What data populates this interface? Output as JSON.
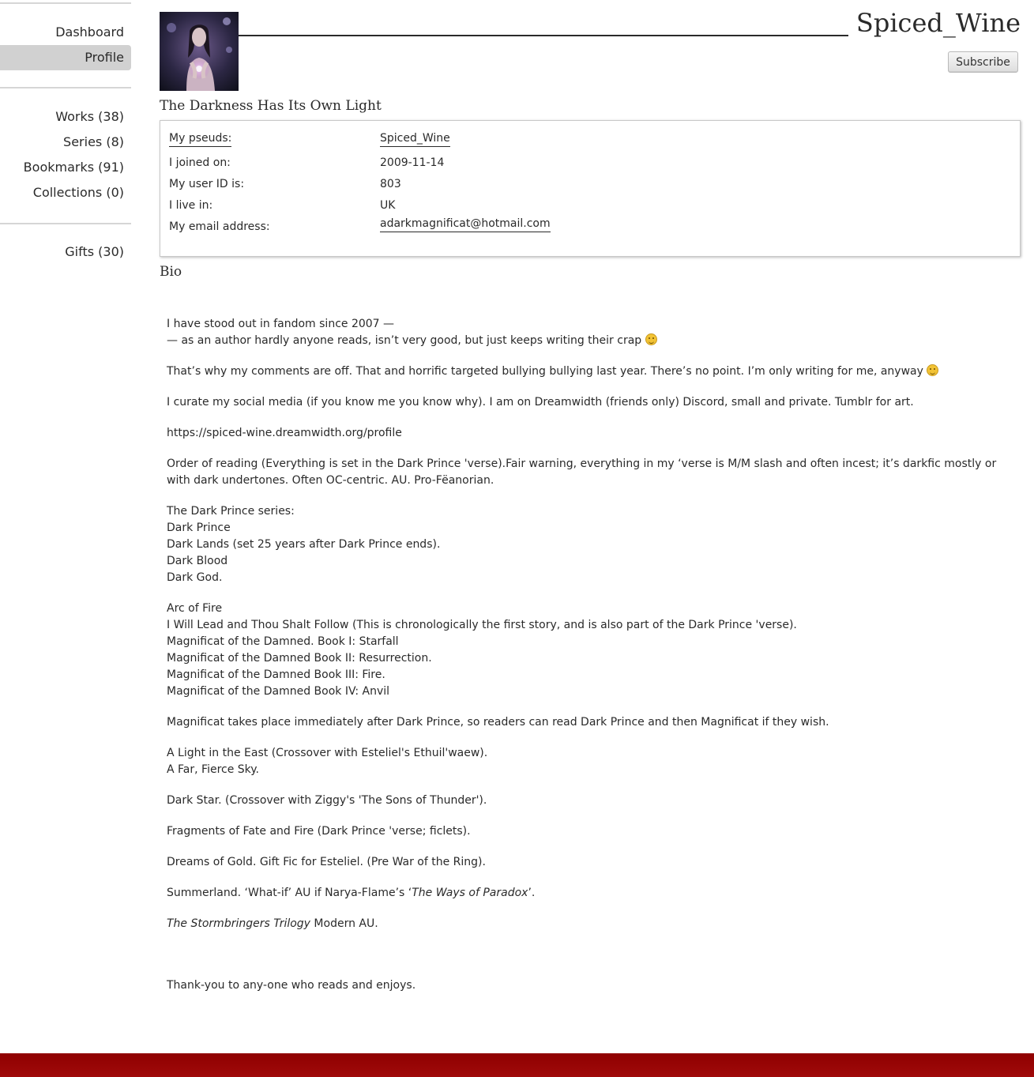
{
  "sidebar": {
    "nav": [
      {
        "label": "Dashboard"
      },
      {
        "label": "Profile"
      }
    ],
    "counts": [
      {
        "label": "Works (38)"
      },
      {
        "label": "Series (8)"
      },
      {
        "label": "Bookmarks (91)"
      },
      {
        "label": "Collections (0)"
      }
    ],
    "gifts": {
      "label": "Gifts (30)"
    }
  },
  "header": {
    "username": "Spiced_Wine",
    "subscribe_label": "Subscribe",
    "tagline": "The Darkness Has Its Own Light"
  },
  "meta": {
    "pseuds": {
      "label": "My pseuds:",
      "value": "Spiced_Wine"
    },
    "joined": {
      "label": "I joined on:",
      "value": "2009-11-14"
    },
    "user_id": {
      "label": "My user ID is:",
      "value": "803"
    },
    "location": {
      "label": "I live in:",
      "value": "UK"
    },
    "email": {
      "label": "My email address:",
      "value": "adarkmagnificat@hotmail.com"
    }
  },
  "bio": {
    "title": "Bio",
    "intro_line1": "I have stood out in fandom since 2007 —",
    "intro_line2": "— as an author hardly anyone reads, isn’t very good, but just keeps writing their crap",
    "comments": "That’s why my comments are off. That and horrific targeted bullying bullying last year. There’s no point. I’m only writing for me, anyway",
    "social": "I curate my social media (if you know me you know why). I am on Dreamwidth (friends only) Discord, small and private. Tumblr for art.",
    "link": "https://spiced-wine.dreamwidth.org/profile",
    "order": "Order of reading (Everything is set in the Dark Prince 'verse).Fair warning, everything in my ‘verse is M/M slash and often incest; it’s darkfic mostly or with dark undertones. Often OC-centric. AU. Pro-Fëanorian.",
    "dark_prince_series": [
      "The Dark Prince series:",
      "Dark Prince",
      "Dark Lands (set 25 years after Dark Prince ends).",
      "Dark Blood",
      "Dark God."
    ],
    "arc_of_fire": [
      "Arc of Fire",
      "I Will Lead and Thou Shalt Follow (This is chronologically the first story, and is also part of the Dark Prince 'verse).",
      "Magnificat of the Damned. Book I: Starfall",
      "Magnificat of the Damned Book II: Resurrection.",
      "Magnificat of the Damned Book III: Fire.",
      "Magnificat of the Damned Book IV: Anvil"
    ],
    "magnificat_note": "Magnificat takes place immediately after Dark Prince, so readers can read Dark Prince and then Magnificat if they wish.",
    "light_east": [
      "A Light in the East (Crossover with Esteliel's Ethuil'waew).",
      "A Far, Fierce Sky."
    ],
    "dark_star": "Dark Star. (Crossover with Ziggy's 'The Sons of Thunder').",
    "fragments": "Fragments of Fate and Fire (Dark Prince 'verse; ficlets).",
    "dreams": "Dreams of Gold. Gift Fic for Esteliel. (Pre War of the Ring).",
    "summerland_prefix": "Summerland. ‘What-if’ AU if Narya-Flame’s ‘",
    "summerland_title": "The Ways of Paradox",
    "summerland_suffix": "’.",
    "stormbringers_title": "The Stormbringers Trilogy",
    "stormbringers_suffix": " Modern AU.",
    "thanks": "Thank-you to any-one who reads and enjoys.",
    "emoji_1": "rolling-on-floor-laughing-emoji",
    "emoji_2": "smiling-face-emoji"
  },
  "colors": {
    "footer": "#990000",
    "current_nav_bg": "#d1d1d1"
  }
}
